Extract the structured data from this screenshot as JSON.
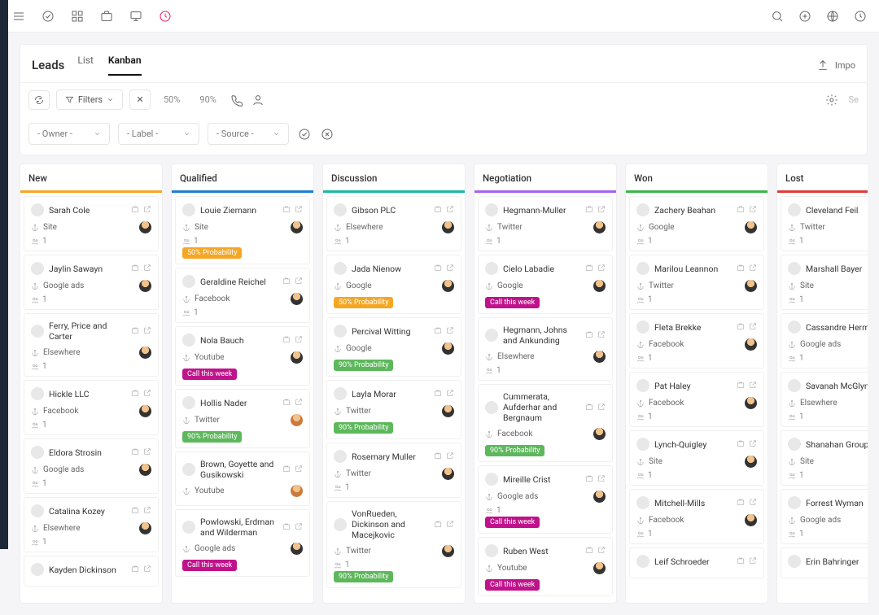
{
  "header": {
    "title": "Leads",
    "tabs": [
      "List",
      "Kanban"
    ],
    "activeTab": 1,
    "importLabel": "Impo"
  },
  "tools": {
    "filtersLabel": "Filters",
    "chips": [
      "50%",
      "90%"
    ],
    "searchPlaceholder": "Se"
  },
  "selects": {
    "owner": "- Owner -",
    "label": "- Label -",
    "source": "- Source -"
  },
  "columns": [
    {
      "name": "New",
      "color": "#f5a623",
      "cards": [
        {
          "name": "Sarah Cole",
          "source": "Site",
          "count": 1
        },
        {
          "name": "Jaylin Sawayn",
          "source": "Google ads",
          "count": 1
        },
        {
          "name": "Ferry, Price and Carter",
          "source": "Elsewhere",
          "count": 1
        },
        {
          "name": "Hickle LLC",
          "source": "Facebook",
          "count": 1
        },
        {
          "name": "Eldora Strosin",
          "source": "Google ads",
          "count": 1
        },
        {
          "name": "Catalina Kozey",
          "source": "Elsewhere",
          "count": 1
        },
        {
          "name": "Kayden Dickinson",
          "source": "",
          "count": null
        }
      ]
    },
    {
      "name": "Qualified",
      "color": "#1f7ed0",
      "cards": [
        {
          "name": "Louie Ziemann",
          "source": "Site",
          "count": 1,
          "badge": {
            "text": "50% Probability",
            "cls": "b-orange"
          }
        },
        {
          "name": "Geraldine Reichel",
          "source": "Facebook",
          "count": 1
        },
        {
          "name": "Nola Bauch",
          "source": "Youtube",
          "count": null,
          "badge": {
            "text": "Call this week",
            "cls": "b-pink"
          }
        },
        {
          "name": "Hollis Nader",
          "source": "Twitter",
          "count": null,
          "assignee": "w",
          "badge": {
            "text": "90% Probability",
            "cls": "b-green"
          }
        },
        {
          "name": "Brown, Goyette and Gusikowski",
          "source": "Youtube",
          "count": null,
          "assignee": "w"
        },
        {
          "name": "Powlowski, Erdman and Wilderman",
          "source": "Google ads",
          "count": null,
          "badge": {
            "text": "Call this week",
            "cls": "b-pink"
          }
        }
      ]
    },
    {
      "name": "Discussion",
      "color": "#17b8a6",
      "cards": [
        {
          "name": "Gibson PLC",
          "source": "Elsewhere",
          "count": 1
        },
        {
          "name": "Jada Nienow",
          "source": "Google",
          "count": null,
          "badge": {
            "text": "50% Probability",
            "cls": "b-orange"
          }
        },
        {
          "name": "Percival Witting",
          "source": "Google",
          "count": null,
          "badge": {
            "text": "90% Probability",
            "cls": "b-green"
          }
        },
        {
          "name": "Layla Morar",
          "source": "Twitter",
          "count": null,
          "badge": {
            "text": "90% Probability",
            "cls": "b-green"
          }
        },
        {
          "name": "Rosemary Muller",
          "source": "Twitter",
          "count": 1
        },
        {
          "name": "VonRueden, Dickinson and Macejkovic",
          "source": "Twitter",
          "count": 1,
          "badge": {
            "text": "90% Probability",
            "cls": "b-green"
          }
        }
      ]
    },
    {
      "name": "Negotiation",
      "color": "#a463f2",
      "cards": [
        {
          "name": "Hegmann-Muller",
          "source": "Twitter",
          "count": 1
        },
        {
          "name": "Cielo Labadie",
          "source": "Google",
          "count": null,
          "badge": {
            "text": "Call this week",
            "cls": "b-pink"
          }
        },
        {
          "name": "Hegmann, Johns and Ankunding",
          "source": "Elsewhere",
          "count": 1
        },
        {
          "name": "Cummerata, Aufderhar and Bergnaum",
          "source": "Facebook",
          "count": null,
          "badge": {
            "text": "90% Probability",
            "cls": "b-green"
          }
        },
        {
          "name": "Mireille Crist",
          "source": "Google ads",
          "count": 1,
          "badge": {
            "text": "Call this week",
            "cls": "b-pink"
          }
        },
        {
          "name": "Ruben West",
          "source": "Youtube",
          "count": null,
          "badge": {
            "text": "Call this week",
            "cls": "b-pink"
          }
        }
      ]
    },
    {
      "name": "Won",
      "color": "#3bb54a",
      "cards": [
        {
          "name": "Zachery Beahan",
          "source": "Google",
          "count": 1
        },
        {
          "name": "Marilou Leannon",
          "source": "Twitter",
          "count": 1
        },
        {
          "name": "Fleta Brekke",
          "source": "Facebook",
          "count": 1
        },
        {
          "name": "Pat Haley",
          "source": "Facebook",
          "count": 1
        },
        {
          "name": "Lynch-Quigley",
          "source": "Site",
          "count": 1
        },
        {
          "name": "Mitchell-Mills",
          "source": "Facebook",
          "count": 1
        },
        {
          "name": "Leif Schroeder",
          "source": "",
          "count": null
        }
      ]
    },
    {
      "name": "Lost",
      "color": "#e23b3b",
      "cards": [
        {
          "name": "Cleveland Feil",
          "source": "Twitter",
          "count": 1,
          "assignee": "w"
        },
        {
          "name": "Marshall Bayer",
          "source": "Site",
          "count": 1
        },
        {
          "name": "Cassandre Herman",
          "source": "Google ads",
          "count": 1
        },
        {
          "name": "Savanah McGlynn",
          "source": "Elsewhere",
          "count": 1,
          "assignee": "w"
        },
        {
          "name": "Shanahan Group",
          "source": "Site",
          "count": 1
        },
        {
          "name": "Forrest Wyman",
          "source": "Google ads",
          "count": 1
        },
        {
          "name": "Erin Bahringer",
          "source": "",
          "count": null
        }
      ]
    }
  ]
}
